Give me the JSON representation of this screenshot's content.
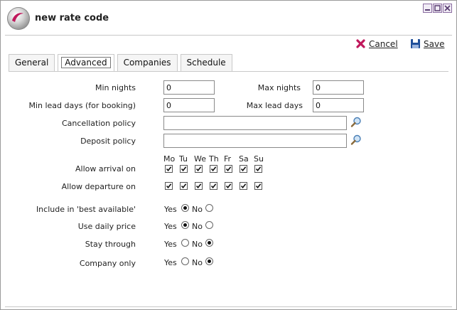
{
  "window": {
    "title": "new rate code"
  },
  "toolbar": {
    "cancel_label": "Cancel",
    "save_label": "Save"
  },
  "tabs": [
    {
      "label": "General",
      "active": false
    },
    {
      "label": "Advanced",
      "active": true
    },
    {
      "label": "Companies",
      "active": false
    },
    {
      "label": "Schedule",
      "active": false
    }
  ],
  "form": {
    "min_nights": {
      "label": "Min nights",
      "value": "0"
    },
    "max_nights": {
      "label": "Max nights",
      "value": "0"
    },
    "min_lead_days": {
      "label": "Min lead days (for booking)",
      "value": "0"
    },
    "max_lead_days": {
      "label": "Max lead days",
      "value": "0"
    },
    "cancellation_policy": {
      "label": "Cancellation policy",
      "value": ""
    },
    "deposit_policy": {
      "label": "Deposit policy",
      "value": ""
    },
    "days": [
      "Mo",
      "Tu",
      "We",
      "Th",
      "Fr",
      "Sa",
      "Su"
    ],
    "allow_arrival": {
      "label": "Allow arrival on",
      "checked": [
        true,
        true,
        true,
        true,
        true,
        true,
        true
      ]
    },
    "allow_departure": {
      "label": "Allow departure on",
      "checked": [
        true,
        true,
        true,
        true,
        true,
        true,
        true
      ]
    },
    "include_best": {
      "label": "Include in 'best available'",
      "value": "Yes"
    },
    "use_daily_price": {
      "label": "Use daily price",
      "value": "Yes"
    },
    "stay_through": {
      "label": "Stay through",
      "value": "No"
    },
    "company_only": {
      "label": "Company only",
      "value": "No"
    },
    "yes_label": "Yes",
    "no_label": "No"
  },
  "colors": {
    "cancel_icon": "#c0185c",
    "save_icon": "#1f4f9a",
    "window_buttons": "#8a6ca0"
  }
}
